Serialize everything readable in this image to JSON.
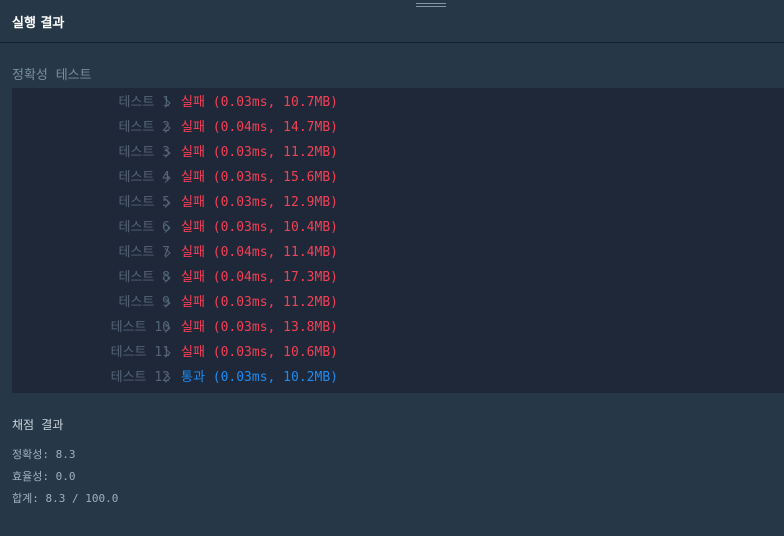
{
  "header": {
    "title": "실행 결과"
  },
  "accuracy_section": {
    "title": "정확성  테스트"
  },
  "tests": [
    {
      "label": "테스트 1",
      "status": "실패 (0.03ms, 10.7MB)",
      "result": "fail"
    },
    {
      "label": "테스트 2",
      "status": "실패 (0.04ms, 14.7MB)",
      "result": "fail"
    },
    {
      "label": "테스트 3",
      "status": "실패 (0.03ms, 11.2MB)",
      "result": "fail"
    },
    {
      "label": "테스트 4",
      "status": "실패 (0.03ms, 15.6MB)",
      "result": "fail"
    },
    {
      "label": "테스트 5",
      "status": "실패 (0.03ms, 12.9MB)",
      "result": "fail"
    },
    {
      "label": "테스트 6",
      "status": "실패 (0.03ms, 10.4MB)",
      "result": "fail"
    },
    {
      "label": "테스트 7",
      "status": "실패 (0.04ms, 11.4MB)",
      "result": "fail"
    },
    {
      "label": "테스트 8",
      "status": "실패 (0.04ms, 17.3MB)",
      "result": "fail"
    },
    {
      "label": "테스트 9",
      "status": "실패 (0.03ms, 11.2MB)",
      "result": "fail"
    },
    {
      "label": "테스트 10",
      "status": "실패 (0.03ms, 13.8MB)",
      "result": "fail"
    },
    {
      "label": "테스트 11",
      "status": "실패 (0.03ms, 10.6MB)",
      "result": "fail"
    },
    {
      "label": "테스트 12",
      "status": "통과 (0.03ms, 10.2MB)",
      "result": "pass"
    }
  ],
  "score": {
    "title": "채점 결과",
    "accuracy": "정확성: 8.3",
    "efficiency": "효율성: 0.0",
    "total": "합계: 8.3 / 100.0"
  },
  "colors": {
    "background": "#263747",
    "panel": "#1f2838",
    "fail": "#f24055",
    "pass": "#1e8bf0",
    "label": "#546478"
  },
  "icons": {
    "chevron": "chevron-right-icon",
    "handle": "drag-handle-icon"
  }
}
